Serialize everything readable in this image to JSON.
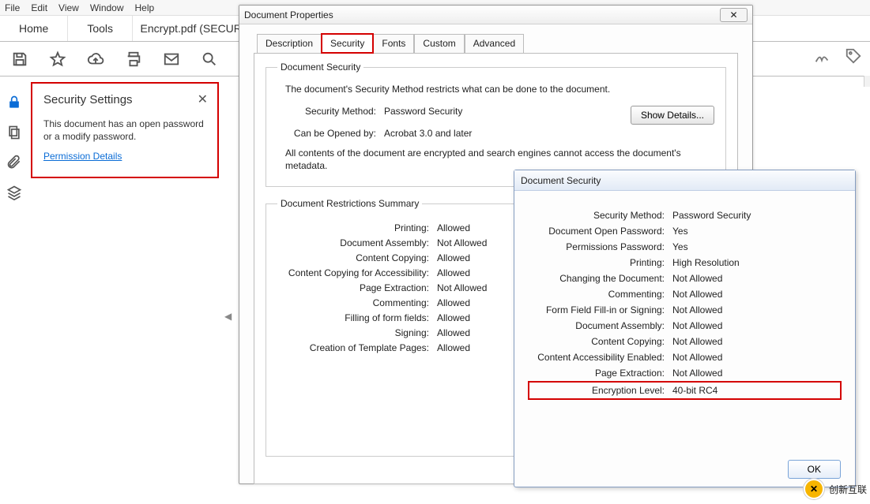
{
  "menubar": {
    "items": [
      "File",
      "Edit",
      "View",
      "Window",
      "Help"
    ]
  },
  "maintabs": {
    "home": "Home",
    "tools": "Tools",
    "doc": "Encrypt.pdf (SECUR..."
  },
  "sidepanel": {
    "title": "Security Settings",
    "body": "This document has an open password or a modify password.",
    "link": "Permission Details"
  },
  "props_dialog": {
    "title": "Document Properties",
    "tabs": [
      "Description",
      "Security",
      "Fonts",
      "Custom",
      "Advanced"
    ],
    "docsec_legend": "Document Security",
    "intro": "The document's Security Method restricts what can be done to the document.",
    "method_k": "Security Method:",
    "method_v": "Password Security",
    "opened_k": "Can be Opened by:",
    "opened_v": "Acrobat 3.0 and later",
    "showdetails": "Show Details...",
    "encrypted_note": "All contents of the document are encrypted and search engines cannot access the document's metadata.",
    "restrict_legend": "Document Restrictions Summary",
    "restrictions": [
      {
        "k": "Printing:",
        "v": "Allowed"
      },
      {
        "k": "Document Assembly:",
        "v": "Not Allowed"
      },
      {
        "k": "Content Copying:",
        "v": "Allowed"
      },
      {
        "k": "Content Copying for Accessibility:",
        "v": "Allowed"
      },
      {
        "k": "Page Extraction:",
        "v": "Not Allowed"
      },
      {
        "k": "Commenting:",
        "v": "Allowed"
      },
      {
        "k": "Filling of form fields:",
        "v": "Allowed"
      },
      {
        "k": "Signing:",
        "v": "Allowed"
      },
      {
        "k": "Creation of Template Pages:",
        "v": "Allowed"
      }
    ]
  },
  "sec_dialog": {
    "title": "Document Security",
    "rows": [
      {
        "k": "Security Method:",
        "v": "Password Security"
      },
      {
        "k": "Document Open Password:",
        "v": "Yes"
      },
      {
        "k": "Permissions Password:",
        "v": "Yes"
      },
      {
        "k": "Printing:",
        "v": "High Resolution"
      },
      {
        "k": "Changing the Document:",
        "v": "Not Allowed"
      },
      {
        "k": "Commenting:",
        "v": "Not Allowed"
      },
      {
        "k": "Form Field Fill-in or Signing:",
        "v": "Not Allowed"
      },
      {
        "k": "Document Assembly:",
        "v": "Not Allowed"
      },
      {
        "k": "Content Copying:",
        "v": "Not Allowed"
      },
      {
        "k": "Content Accessibility Enabled:",
        "v": "Not Allowed"
      },
      {
        "k": "Page Extraction:",
        "v": "Not Allowed"
      },
      {
        "k": "Encryption Level:",
        "v": "40-bit RC4"
      }
    ],
    "ok": "OK"
  },
  "watermark": {
    "text": "创新互联"
  }
}
